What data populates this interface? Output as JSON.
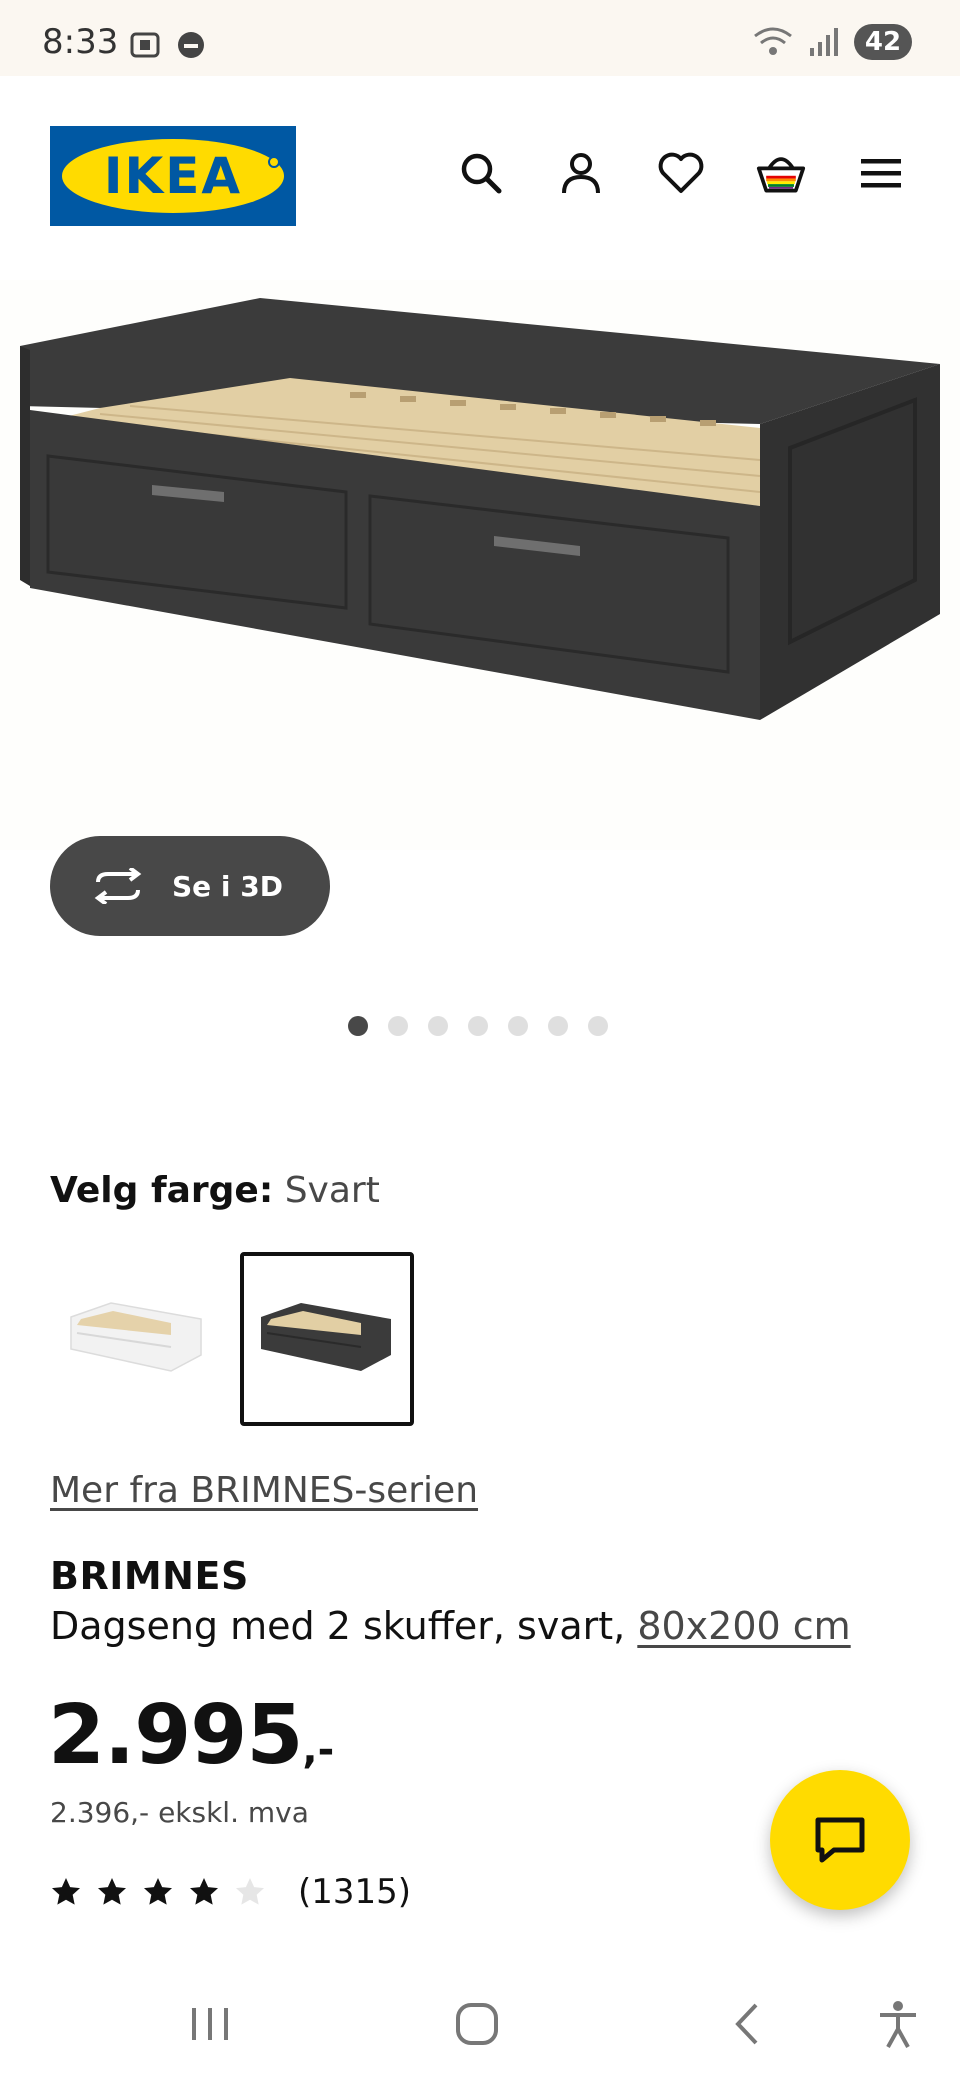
{
  "status_bar": {
    "time": "8:33",
    "battery": "42"
  },
  "header": {
    "brand": "IKEA",
    "icons": [
      "search-icon",
      "account-icon",
      "heart-icon",
      "basket-icon",
      "menu-icon"
    ]
  },
  "gallery": {
    "view_3d_label": "Se i 3D",
    "image_count": 7,
    "active_index": 0
  },
  "color": {
    "label": "Velg farge:",
    "value": "Svart",
    "options": [
      "Hvit",
      "Svart"
    ],
    "selected_index": 1
  },
  "series_link": "Mer fra BRIMNES-serien",
  "product": {
    "name": "BRIMNES",
    "description": "Dagseng med 2 skuffer, svart,",
    "size": "80x200 cm"
  },
  "price": {
    "main": "2.995",
    "suffix": ",-",
    "excl_vat": "2.396,- ekskl. mva"
  },
  "rating": {
    "stars": 4,
    "max": 5,
    "count": "(1315)"
  },
  "colors": {
    "ikea_blue": "#0058a3",
    "ikea_yellow": "#ffdb00",
    "dark_button": "#484848"
  }
}
